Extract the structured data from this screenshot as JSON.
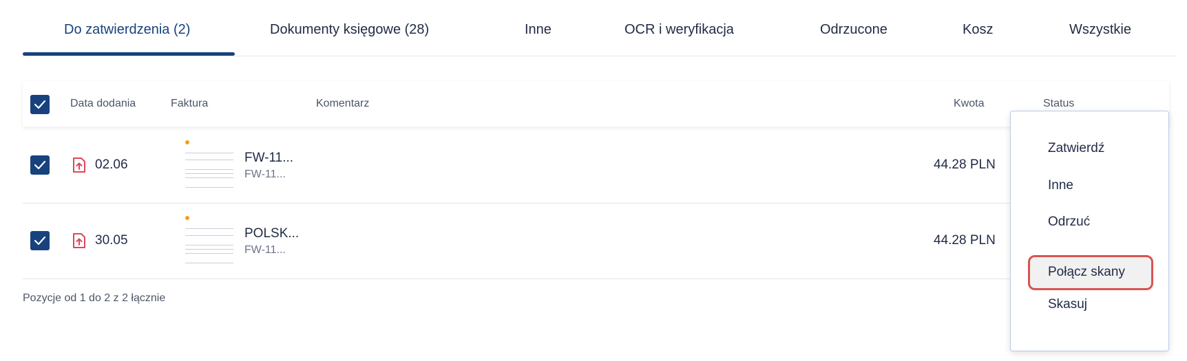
{
  "tabs": [
    {
      "label": "Do zatwierdzenia (2)",
      "active": true
    },
    {
      "label": "Dokumenty księgowe (28)"
    },
    {
      "label": "Inne"
    },
    {
      "label": "OCR i weryfikacja"
    },
    {
      "label": "Odrzucone"
    },
    {
      "label": "Kosz"
    },
    {
      "label": "Wszystkie"
    }
  ],
  "table": {
    "headers": {
      "date": "Data dodania",
      "invoice": "Faktura",
      "comment": "Komentarz",
      "amount": "Kwota",
      "status": "Status"
    },
    "rows": [
      {
        "date": "02.06",
        "title": "FW-11...",
        "subtitle": "FW-11...",
        "amount": "44.28 PLN",
        "checked": true
      },
      {
        "date": "30.05",
        "title": "POLSK...",
        "subtitle": "FW-11...",
        "amount": "44.28 PLN",
        "checked": true
      }
    ],
    "footer": "Pozycje od 1 do 2 z 2 łącznie"
  },
  "menu": {
    "items": [
      {
        "label": "Zatwierdź"
      },
      {
        "label": "Inne"
      },
      {
        "label": "Odrzuć"
      },
      {
        "label": "Połącz skany",
        "highlighted": true
      },
      {
        "label": "Skasuj"
      }
    ]
  },
  "colors": {
    "accent": "#17427e",
    "highlight_border": "#d9534f",
    "pdf_icon": "#e0455a"
  }
}
